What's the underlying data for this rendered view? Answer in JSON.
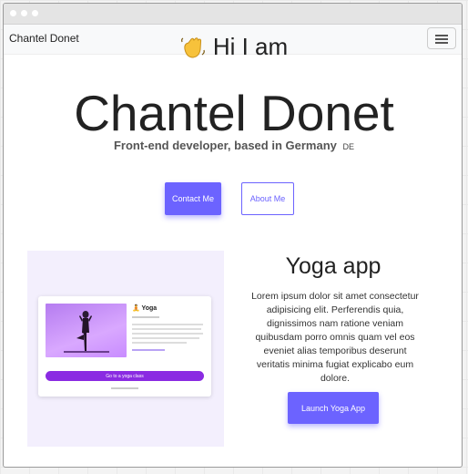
{
  "navbar": {
    "brand": "Chantel Donet",
    "menu_icon": "hamburger-menu-icon"
  },
  "hero": {
    "greeting_icon": "waving-hand-icon",
    "greeting": "Hi I am",
    "name": "Chantel Donet",
    "subtitle": "Front-end developer, based in Germany",
    "flag": "DE",
    "contact_label": "Contact Me",
    "about_label": "About Me"
  },
  "project": {
    "title": "Yoga app",
    "description": "Lorem ipsum dolor sit amet consectetur adipisicing elit. Perferendis quia, dignissimos nam ratione veniam quibusdam porro omnis quam vel eos eveniet alias temporibus deserunt veritatis minima fugiat explicabo eum dolore.",
    "launch_label": "Launch Yoga App",
    "preview": {
      "title": "Yoga",
      "button_label": "Go to a yoga class"
    }
  },
  "colors": {
    "accent": "#6c63ff",
    "preview_bg": "#f3effd",
    "preview_button": "#8a2be2"
  }
}
